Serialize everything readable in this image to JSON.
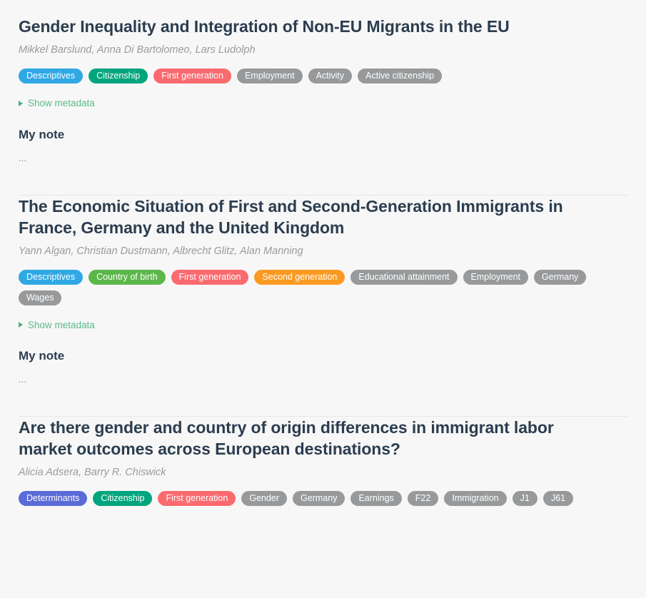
{
  "labels": {
    "show_metadata": "Show metadata",
    "note_heading": "My note",
    "note_placeholder": "..."
  },
  "colors": {
    "background": "#f7f7f7",
    "title": "#2b3d4f",
    "authors": "#9b9b9b",
    "link_green": "#5cba8a",
    "tag_blue": "#2fa8e4",
    "tag_teal": "#00a57d",
    "tag_red": "#fa6a6f",
    "tag_green": "#5cb74b",
    "tag_orange": "#fb9a22",
    "tag_indigo": "#5a6ad8",
    "tag_gray": "#97999b",
    "divider": "#e7e7e7"
  },
  "entries": [
    {
      "title": "Gender Inequality and Integration of Non-EU Migrants in the EU",
      "authors": "Mikkel Barslund, Anna Di Bartolomeo, Lars Ludolph",
      "tags": [
        {
          "label": "Descriptives",
          "color": "blue"
        },
        {
          "label": "Citizenship",
          "color": "teal"
        },
        {
          "label": "First generation",
          "color": "red"
        },
        {
          "label": "Employment",
          "color": "gray"
        },
        {
          "label": "Activity",
          "color": "gray"
        },
        {
          "label": "Active citizenship",
          "color": "gray"
        }
      ],
      "show_metadata": "Show metadata",
      "note_heading": "My note",
      "note_body": "..."
    },
    {
      "title": "The Economic Situation of First and Second-Generation Immigrants in France, Germany and the United Kingdom",
      "authors": "Yann Algan, Christian Dustmann, Albrecht Glitz, Alan Manning",
      "tags": [
        {
          "label": "Descriptives",
          "color": "blue"
        },
        {
          "label": "Country of birth",
          "color": "green"
        },
        {
          "label": "First generation",
          "color": "red"
        },
        {
          "label": "Second generation",
          "color": "orange"
        },
        {
          "label": "Educational attainment",
          "color": "gray"
        },
        {
          "label": "Employment",
          "color": "gray"
        },
        {
          "label": "Germany",
          "color": "gray"
        },
        {
          "label": "Wages",
          "color": "gray"
        }
      ],
      "show_metadata": "Show metadata",
      "note_heading": "My note",
      "note_body": "..."
    },
    {
      "title": "Are there gender and country of origin differences in immigrant labor market outcomes across European destinations?",
      "authors": "Alicia Adsera, Barry R. Chiswick",
      "tags": [
        {
          "label": "Determinants",
          "color": "indigo"
        },
        {
          "label": "Citizenship",
          "color": "teal"
        },
        {
          "label": "First generation",
          "color": "red"
        },
        {
          "label": "Gender",
          "color": "gray"
        },
        {
          "label": "Germany",
          "color": "gray"
        },
        {
          "label": "Earnings",
          "color": "gray"
        },
        {
          "label": "F22",
          "color": "gray"
        },
        {
          "label": "Immigration",
          "color": "gray"
        },
        {
          "label": "J1",
          "color": "gray"
        },
        {
          "label": "J61",
          "color": "gray"
        }
      ]
    }
  ]
}
